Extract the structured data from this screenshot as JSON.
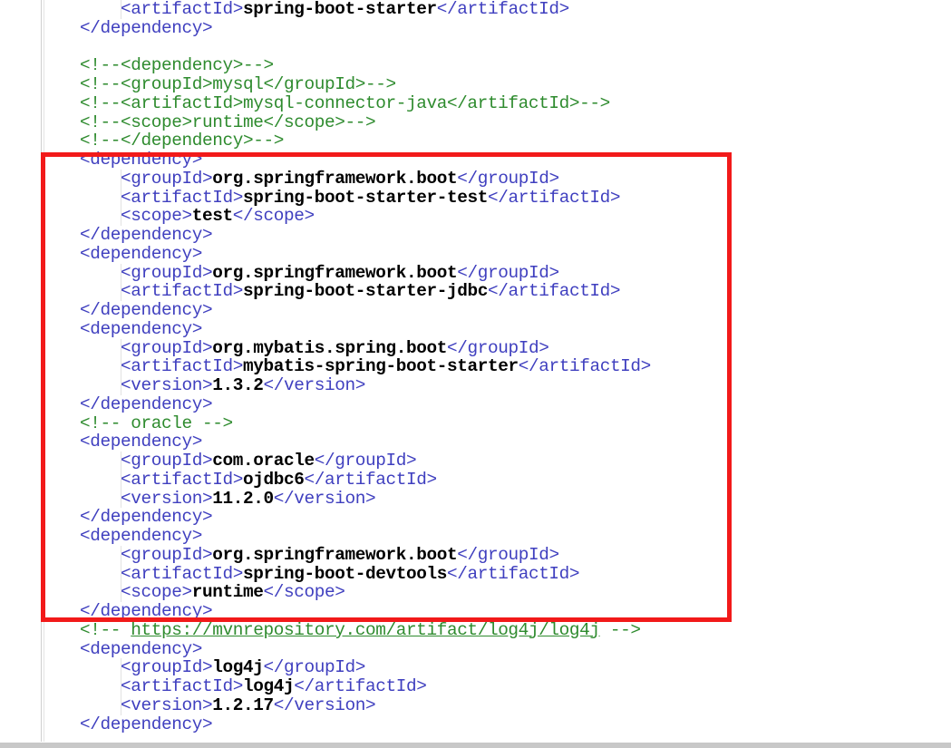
{
  "editor": {
    "language": "xml",
    "file_kind": "maven-pom",
    "background_color": "#ffffff",
    "tag_color": "#3f3fbf",
    "value_color": "#000000",
    "comment_color": "#2e8b2e",
    "annotation_color": "#f21a1a"
  },
  "annotation": {
    "shape": "rectangle",
    "color": "#f21a1a",
    "label": "highlighted-dependencies-region"
  },
  "code_lines": [
    {
      "id": "l1",
      "indent": 1,
      "segments": [
        {
          "cls": "tag",
          "text": "<artifactId>"
        },
        {
          "cls": "val",
          "text": "spring-boot-starter"
        },
        {
          "cls": "tag",
          "text": "</artifactId>"
        }
      ]
    },
    {
      "id": "l2",
      "indent": 0,
      "segments": [
        {
          "cls": "tag",
          "text": "</dependency>"
        }
      ]
    },
    {
      "id": "l3",
      "indent": 0,
      "segments": [
        {
          "cls": "plain",
          "text": ""
        }
      ]
    },
    {
      "id": "l4",
      "indent": 0,
      "segments": [
        {
          "cls": "comment",
          "text": "<!--<dependency>-->"
        }
      ]
    },
    {
      "id": "l5",
      "indent": 0,
      "segments": [
        {
          "cls": "comment",
          "text": "<!--<groupId>mysql</groupId>-->"
        }
      ]
    },
    {
      "id": "l6",
      "indent": 0,
      "segments": [
        {
          "cls": "comment",
          "text": "<!--<artifactId>mysql-connector-java</artifactId>-->"
        }
      ]
    },
    {
      "id": "l7",
      "indent": 0,
      "segments": [
        {
          "cls": "comment",
          "text": "<!--<scope>runtime</scope>-->"
        }
      ]
    },
    {
      "id": "l8",
      "indent": 0,
      "segments": [
        {
          "cls": "comment",
          "text": "<!--</dependency>-->"
        }
      ]
    },
    {
      "id": "l9",
      "indent": 0,
      "segments": [
        {
          "cls": "tag",
          "text": "<dependency>"
        }
      ]
    },
    {
      "id": "l10",
      "indent": 1,
      "segments": [
        {
          "cls": "tag",
          "text": "<groupId>"
        },
        {
          "cls": "val",
          "text": "org.springframework.boot"
        },
        {
          "cls": "tag",
          "text": "</groupId>"
        }
      ]
    },
    {
      "id": "l11",
      "indent": 1,
      "segments": [
        {
          "cls": "tag",
          "text": "<artifactId>"
        },
        {
          "cls": "val",
          "text": "spring-boot-starter-test"
        },
        {
          "cls": "tag",
          "text": "</artifactId>"
        }
      ]
    },
    {
      "id": "l12",
      "indent": 1,
      "segments": [
        {
          "cls": "tag",
          "text": "<scope>"
        },
        {
          "cls": "val",
          "text": "test"
        },
        {
          "cls": "tag",
          "text": "</scope>"
        }
      ]
    },
    {
      "id": "l13",
      "indent": 0,
      "segments": [
        {
          "cls": "tag",
          "text": "</dependency>"
        }
      ]
    },
    {
      "id": "l14",
      "indent": 0,
      "segments": [
        {
          "cls": "tag",
          "text": "<dependency>"
        }
      ]
    },
    {
      "id": "l15",
      "indent": 1,
      "segments": [
        {
          "cls": "tag",
          "text": "<groupId>"
        },
        {
          "cls": "val",
          "text": "org.springframework.boot"
        },
        {
          "cls": "tag",
          "text": "</groupId>"
        }
      ]
    },
    {
      "id": "l16",
      "indent": 1,
      "segments": [
        {
          "cls": "tag",
          "text": "<artifactId>"
        },
        {
          "cls": "val",
          "text": "spring-boot-starter-jdbc"
        },
        {
          "cls": "tag",
          "text": "</artifactId>"
        }
      ]
    },
    {
      "id": "l17",
      "indent": 0,
      "segments": [
        {
          "cls": "tag",
          "text": "</dependency>"
        }
      ]
    },
    {
      "id": "l18",
      "indent": 0,
      "segments": [
        {
          "cls": "tag",
          "text": "<dependency>"
        }
      ]
    },
    {
      "id": "l19",
      "indent": 1,
      "segments": [
        {
          "cls": "tag",
          "text": "<groupId>"
        },
        {
          "cls": "val",
          "text": "org.mybatis.spring.boot"
        },
        {
          "cls": "tag",
          "text": "</groupId>"
        }
      ]
    },
    {
      "id": "l20",
      "indent": 1,
      "segments": [
        {
          "cls": "tag",
          "text": "<artifactId>"
        },
        {
          "cls": "val",
          "text": "mybatis-spring-boot-starter"
        },
        {
          "cls": "tag",
          "text": "</artifactId>"
        }
      ]
    },
    {
      "id": "l21",
      "indent": 1,
      "segments": [
        {
          "cls": "tag",
          "text": "<version>"
        },
        {
          "cls": "val",
          "text": "1.3.2"
        },
        {
          "cls": "tag",
          "text": "</version>"
        }
      ]
    },
    {
      "id": "l22",
      "indent": 0,
      "segments": [
        {
          "cls": "tag",
          "text": "</dependency>"
        }
      ]
    },
    {
      "id": "l23",
      "indent": 0,
      "segments": [
        {
          "cls": "comment",
          "text": "<!-- oracle -->"
        }
      ]
    },
    {
      "id": "l24",
      "indent": 0,
      "segments": [
        {
          "cls": "tag",
          "text": "<dependency>"
        }
      ]
    },
    {
      "id": "l25",
      "indent": 1,
      "segments": [
        {
          "cls": "tag",
          "text": "<groupId>"
        },
        {
          "cls": "val",
          "text": "com.oracle"
        },
        {
          "cls": "tag",
          "text": "</groupId>"
        }
      ]
    },
    {
      "id": "l26",
      "indent": 1,
      "segments": [
        {
          "cls": "tag",
          "text": "<artifactId>"
        },
        {
          "cls": "val",
          "text": "ojdbc6"
        },
        {
          "cls": "tag",
          "text": "</artifactId>"
        }
      ]
    },
    {
      "id": "l27",
      "indent": 1,
      "segments": [
        {
          "cls": "tag",
          "text": "<version>"
        },
        {
          "cls": "val",
          "text": "11.2.0"
        },
        {
          "cls": "tag",
          "text": "</version>"
        }
      ]
    },
    {
      "id": "l28",
      "indent": 0,
      "segments": [
        {
          "cls": "tag",
          "text": "</dependency>"
        }
      ]
    },
    {
      "id": "l29",
      "indent": 0,
      "segments": [
        {
          "cls": "tag",
          "text": "<dependency>"
        }
      ]
    },
    {
      "id": "l30",
      "indent": 1,
      "segments": [
        {
          "cls": "tag",
          "text": "<groupId>"
        },
        {
          "cls": "val",
          "text": "org.springframework.boot"
        },
        {
          "cls": "tag",
          "text": "</groupId>"
        }
      ]
    },
    {
      "id": "l31",
      "indent": 1,
      "segments": [
        {
          "cls": "tag",
          "text": "<artifactId>"
        },
        {
          "cls": "val",
          "text": "spring-boot-devtools"
        },
        {
          "cls": "tag",
          "text": "</artifactId>"
        }
      ]
    },
    {
      "id": "l32",
      "indent": 1,
      "segments": [
        {
          "cls": "tag",
          "text": "<scope>"
        },
        {
          "cls": "val",
          "text": "runtime"
        },
        {
          "cls": "tag",
          "text": "</scope>"
        }
      ]
    },
    {
      "id": "l33",
      "indent": 0,
      "segments": [
        {
          "cls": "tag",
          "text": "</dependency>"
        }
      ]
    },
    {
      "id": "l34",
      "indent": 0,
      "segments": [
        {
          "cls": "comment",
          "text": "<!-- "
        },
        {
          "cls": "link",
          "text": "https://mvnrepository.com/artifact/log4j/log4j"
        },
        {
          "cls": "comment",
          "text": " -->"
        }
      ]
    },
    {
      "id": "l35",
      "indent": 0,
      "segments": [
        {
          "cls": "tag",
          "text": "<dependency>"
        }
      ]
    },
    {
      "id": "l36",
      "indent": 1,
      "segments": [
        {
          "cls": "tag",
          "text": "<groupId>"
        },
        {
          "cls": "val",
          "text": "log4j"
        },
        {
          "cls": "tag",
          "text": "</groupId>"
        }
      ]
    },
    {
      "id": "l37",
      "indent": 1,
      "segments": [
        {
          "cls": "tag",
          "text": "<artifactId>"
        },
        {
          "cls": "val",
          "text": "log4j"
        },
        {
          "cls": "tag",
          "text": "</artifactId>"
        }
      ]
    },
    {
      "id": "l38",
      "indent": 1,
      "segments": [
        {
          "cls": "tag",
          "text": "<version>"
        },
        {
          "cls": "val",
          "text": "1.2.17"
        },
        {
          "cls": "tag",
          "text": "</version>"
        }
      ]
    },
    {
      "id": "l39",
      "indent": 0,
      "segments": [
        {
          "cls": "tag",
          "text": "</dependency>"
        }
      ]
    }
  ]
}
